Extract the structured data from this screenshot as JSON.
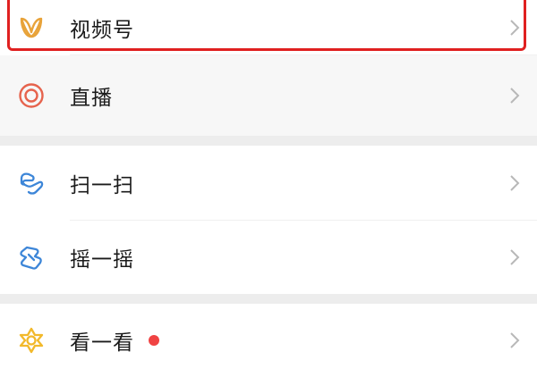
{
  "menu": {
    "items": [
      {
        "label": "视频号",
        "icon": "channels-icon",
        "color": "#e8a33a"
      },
      {
        "label": "直播",
        "icon": "live-icon",
        "color": "#e6634d"
      },
      {
        "label": "扫一扫",
        "icon": "scan-icon",
        "color": "#3d86d8"
      },
      {
        "label": "摇一摇",
        "icon": "shake-icon",
        "color": "#3d86d8"
      },
      {
        "label": "看一看",
        "icon": "top-stories-icon",
        "color": "#f2b92b"
      }
    ]
  },
  "colors": {
    "highlight_border": "#e02020",
    "badge_dot": "#f04343",
    "separator": "#ededed"
  }
}
